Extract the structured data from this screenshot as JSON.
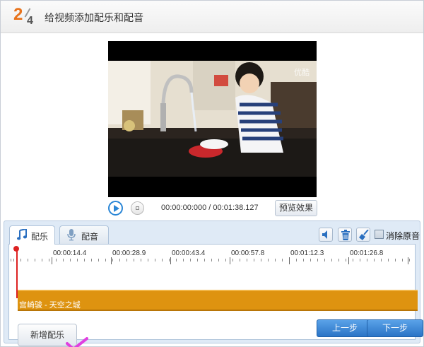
{
  "header": {
    "step_current": "2",
    "step_total": "4",
    "title": "给视频添加配乐和配音"
  },
  "video": {
    "watermark": "优酷"
  },
  "player": {
    "current_time": "00:00:00:000",
    "separator": "/",
    "total_time": "00:01:38.127",
    "preview_label": "预览效果"
  },
  "tabs": [
    {
      "label": "配乐",
      "icon": "music-note-icon",
      "active": true
    },
    {
      "label": "配音",
      "icon": "microphone-icon",
      "active": false
    }
  ],
  "toolbar": {
    "icons": [
      "speaker-icon",
      "trash-icon",
      "broom-icon"
    ],
    "mute_original_label": "消除原音",
    "mute_original_checked": false
  },
  "ruler": {
    "labels": [
      "00:00:14.4",
      "00:00:28.9",
      "00:00:43.4",
      "00:00:57.8",
      "00:01:12.3",
      "00:01:26.8"
    ]
  },
  "music_track": {
    "label": "宫崎骏 - 天空之城"
  },
  "buttons": {
    "add_music": "新增配乐",
    "prev_step": "上一步",
    "next_step": "下一步"
  },
  "colors": {
    "accent_orange": "#de9310",
    "step_orange": "#e8731c",
    "primary_blue": "#2a74c6",
    "check_magenta": "#e040e0"
  }
}
